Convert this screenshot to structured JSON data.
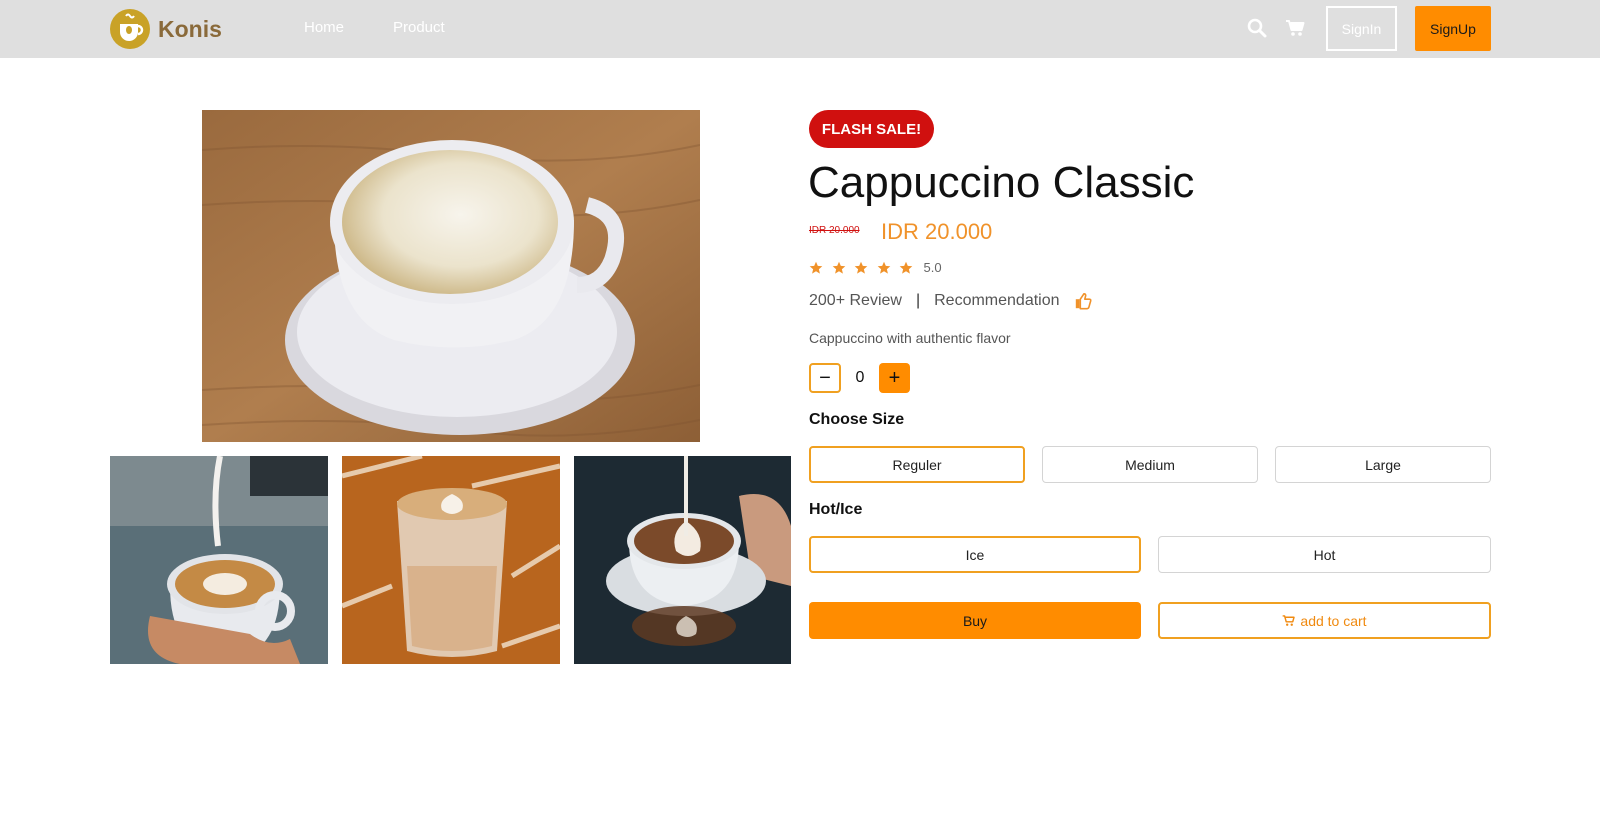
{
  "header": {
    "brand_name": "Konis",
    "logo_icon": "coffee-cup-logo-icon",
    "nav": [
      {
        "label": "Home"
      },
      {
        "label": "Product"
      }
    ],
    "search_icon": "search-icon",
    "cart_icon": "cart-icon",
    "signin_label": "SignIn",
    "signup_label": "SignUp"
  },
  "gallery": {
    "main_image": "cappuccino-cup-on-saucer",
    "thumbnails": [
      "latte-art-pour",
      "latte-glass",
      "latte-art-saucer"
    ]
  },
  "product": {
    "badge": "FLASH SALE!",
    "title": "Cappuccino Classic",
    "old_price": "IDR 20.000",
    "price": "IDR 20.000",
    "stars": 5,
    "rating": "5.0",
    "reviews": "200+ Review",
    "separator": "|",
    "recommendation": "Recommendation",
    "description": "Cappuccino with authentic flavor",
    "quantity": {
      "minus": "−",
      "value": "0",
      "plus": "+"
    },
    "size_label": "Choose Size",
    "sizes": [
      {
        "label": "Reguler",
        "selected": true
      },
      {
        "label": "Medium",
        "selected": false
      },
      {
        "label": "Large",
        "selected": false
      }
    ],
    "temp_label": "Hot/Ice",
    "temps": [
      {
        "label": "Ice",
        "selected": true
      },
      {
        "label": "Hot",
        "selected": false
      }
    ],
    "buy_label": "Buy",
    "add_to_cart_label": "add to cart"
  },
  "colors": {
    "accent": "#ff8c00",
    "sale": "#d0100f",
    "nav_bg": "#dfdfdf"
  }
}
